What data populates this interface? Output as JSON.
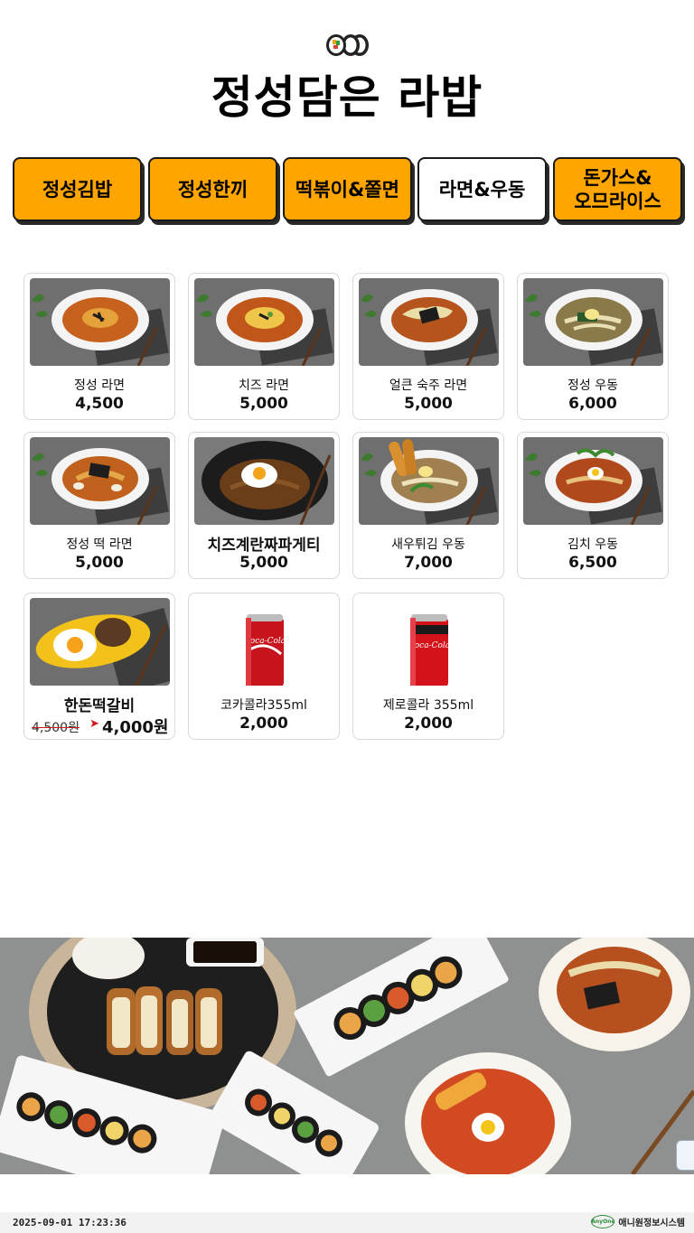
{
  "header": {
    "title": "정성담은 라밥",
    "logo_icon": "gimbap-roll-icon"
  },
  "tabs": [
    {
      "label": "정성김밥",
      "active": false
    },
    {
      "label": "정성한끼",
      "active": false
    },
    {
      "label": "떡볶이&쫄면",
      "active": false
    },
    {
      "label": "라면&우동",
      "active": true
    },
    {
      "label": "돈가스&\n오므라이스",
      "active": false
    }
  ],
  "menu": [
    {
      "name": "정성 라면",
      "price": "4,500",
      "image": "ramen-bowl"
    },
    {
      "name": "치즈 라면",
      "price": "5,000",
      "image": "cheese-ramen-bowl"
    },
    {
      "name": "얼큰 숙주 라면",
      "price": "5,000",
      "image": "beansprout-ramen-bowl"
    },
    {
      "name": "정성 우동",
      "price": "6,000",
      "image": "udon-bowl"
    },
    {
      "name": "정성 떡 라면",
      "price": "5,000",
      "image": "rice-cake-ramen-bowl"
    },
    {
      "name": "치즈계란짜파게티",
      "price": "5,000",
      "image": "jjapaghetti-egg-bowl"
    },
    {
      "name": "새우튀김 우동",
      "price": "7,000",
      "image": "shrimp-tempura-udon-bowl"
    },
    {
      "name": "김치 우동",
      "price": "6,500",
      "image": "kimchi-udon-bowl"
    },
    {
      "name": "한돈떡갈비",
      "old_price": "4,500원",
      "price": "4,000원",
      "image": "tteokgalbi-plate"
    },
    {
      "name": "코카콜라355ml",
      "price": "2,000",
      "image": "coca-cola-can"
    },
    {
      "name": "제로콜라 355ml",
      "price": "2,000",
      "image": "coke-zero-can"
    }
  ],
  "colors": {
    "tab": "#ffa500",
    "tab_active": "#ffffff",
    "border": "#1a1a1a",
    "sale_line": "#d01818"
  },
  "footer": {
    "timestamp": "2025-09-01 17:23:36",
    "brand_name": "애니원정보시스템",
    "brand_mark": "AnyOne"
  }
}
